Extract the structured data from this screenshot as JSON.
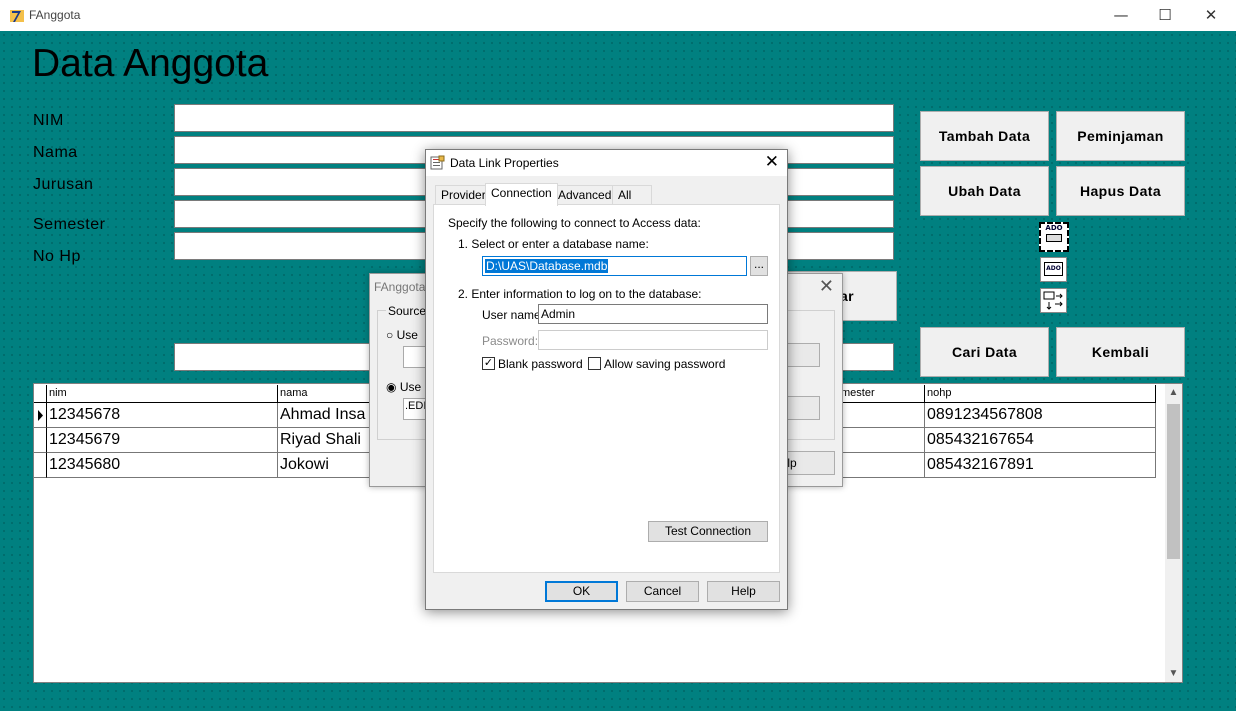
{
  "window": {
    "title": "FAnggota",
    "minimize": "—",
    "maximize": "☐",
    "close": "✕"
  },
  "form": {
    "title": "Data Anggota",
    "labels": [
      "NIM",
      "Nama",
      "Jurusan",
      "Semester",
      "No Hp"
    ]
  },
  "buttons": {
    "tambah": "Tambah Data",
    "peminjaman": "Peminjaman",
    "ubah": "Ubah Data",
    "hapus": "Hapus Data",
    "partial": "ar",
    "cari": "Cari Data",
    "kembali": "Kembali"
  },
  "ado_icons": {
    "adodc": "ADO",
    "datagrid": "ADO"
  },
  "grid": {
    "headers": [
      "nim",
      "nama",
      "mester",
      "nohp"
    ],
    "rows": [
      {
        "nim": "12345678",
        "nama": "Ahmad Insa",
        "nohp": "0891234567808"
      },
      {
        "nim": "12345679",
        "nama": "Riyad Shali",
        "nohp": "085432167654"
      },
      {
        "nim": "12345680",
        "nama": "Jokowi",
        "nohp": "085432167891"
      }
    ]
  },
  "bg_dialog": {
    "caption": "FAnggota",
    "group_title": "Source o",
    "option1": "Use",
    "option2": "Use",
    "conn_fragment": ".EDI",
    "btn_browse": "se...",
    "btn_build": "d...",
    "btn_help": "Help",
    "close": "✕"
  },
  "dialog": {
    "title": "Data Link Properties",
    "close": "✕",
    "tabs": [
      "Provider",
      "Connection",
      "Advanced",
      "All"
    ],
    "active_tab": "Connection",
    "intro": "Specify the following to connect to Access data:",
    "step1": "1. Select or enter a database name:",
    "database_name": "D:\\UAS\\Database.mdb",
    "browse": "...",
    "step2": "2. Enter information to log on to the database:",
    "username_label": "User name:",
    "username": "Admin",
    "password_label": "Password:",
    "password": "",
    "blank_password": {
      "label": "Blank password",
      "checked": true
    },
    "allow_saving": {
      "label": "Allow saving password",
      "checked": false
    },
    "test_connection": "Test Connection",
    "ok": "OK",
    "cancel": "Cancel",
    "help": "Help"
  }
}
